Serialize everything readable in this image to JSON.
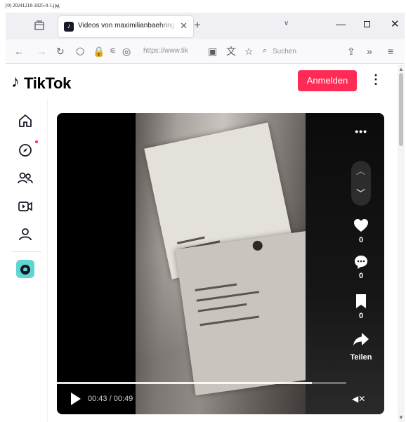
{
  "caption": "[0] 20241218-1825-0-1.jpg",
  "browser": {
    "tab": {
      "title": "Videos von maximilianbaehring",
      "favicon": "tiktok-icon"
    },
    "url": "https://www.tik",
    "search_placeholder": "Suchen"
  },
  "tiktok": {
    "logo": "TikTok",
    "login_label": "Anmelden",
    "accent": "#fe2c55",
    "sidenav": [
      "home-icon",
      "explore-icon",
      "following-icon",
      "live-icon",
      "profile-icon"
    ]
  },
  "video": {
    "like_count": "0",
    "comment_count": "0",
    "bookmark_count": "0",
    "share_label": "Teilen",
    "time": "00:43 / 00:49",
    "progress_fraction": 0.88
  }
}
